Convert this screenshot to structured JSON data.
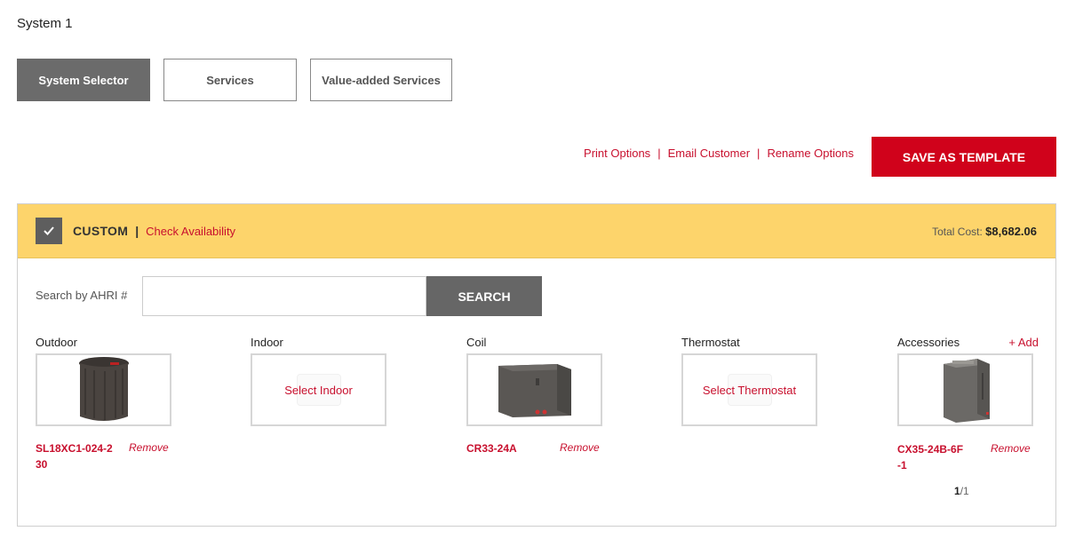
{
  "system_title": "System 1",
  "tabs": [
    {
      "label": "System Selector"
    },
    {
      "label": "Services"
    },
    {
      "label": "Value-added Services"
    }
  ],
  "actions": {
    "print": "Print Options",
    "email": "Email Customer",
    "rename": "Rename Options",
    "separator": "|",
    "save_template": "SAVE AS TEMPLATE"
  },
  "panel": {
    "custom_label": "CUSTOM",
    "divider": "|",
    "check_availability": "Check Availability",
    "total_label": "Total Cost:",
    "total_value": "$8,682.06",
    "search_label": "Search by AHRI #",
    "search_placeholder": "",
    "search_button": "SEARCH"
  },
  "columns": {
    "outdoor": {
      "title": "Outdoor",
      "model_line1": "SL18XC1-024-2",
      "model_line2": "30",
      "remove": "Remove"
    },
    "indoor": {
      "title": "Indoor",
      "select": "Select Indoor"
    },
    "coil": {
      "title": "Coil",
      "model_line1": "CR33-24A",
      "remove": "Remove"
    },
    "thermostat": {
      "title": "Thermostat",
      "select": "Select Thermostat"
    },
    "accessories": {
      "title": "Accessories",
      "add": "+ Add",
      "model_line1": "CX35-24B-6F",
      "model_line2": "-1",
      "remove": "Remove"
    }
  },
  "pager": {
    "current": "1",
    "total": "/1"
  },
  "colors": {
    "accent_red": "#c8102e",
    "save_red": "#d0021b",
    "header_yellow": "#fdd46b",
    "dark_gray": "#666666"
  }
}
